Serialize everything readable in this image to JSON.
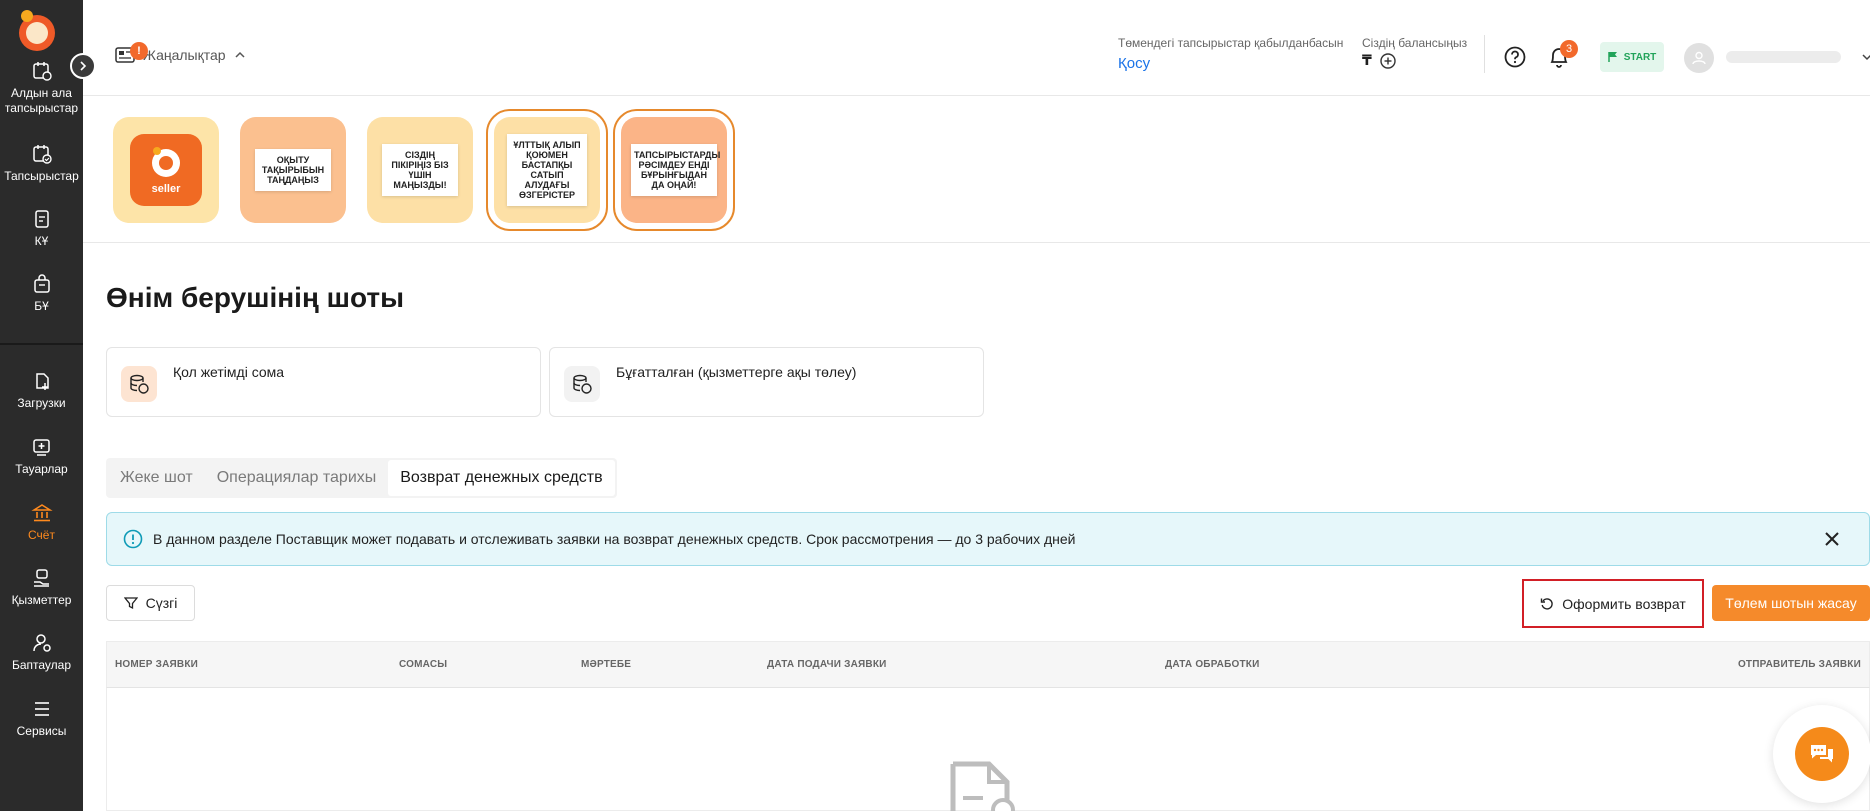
{
  "sidebar": {
    "items": [
      {
        "label": "Алдын ала тапсырыстар",
        "icon": "calendar-clock-icon"
      },
      {
        "label": "Тапсырыстар",
        "icon": "calendar-check-icon"
      },
      {
        "label": "КҰ",
        "icon": "document-icon"
      },
      {
        "label": "БҰ",
        "icon": "bag-icon"
      },
      {
        "label": "Загрузки",
        "icon": "upload-icon"
      },
      {
        "label": "Тауарлар",
        "icon": "add-product-icon"
      },
      {
        "label": "Счёт",
        "icon": "bank-icon",
        "active": true
      },
      {
        "label": "Қызметтер",
        "icon": "services-icon"
      },
      {
        "label": "Баптаулар",
        "icon": "user-settings-icon"
      },
      {
        "label": "Сервисы",
        "icon": "menu-icon"
      }
    ]
  },
  "header": {
    "news_label": "Жаңалықтар",
    "news_badge": "!",
    "bottom_orders_label": "Төмендегі тапсырыстар қабылданбасын",
    "add_link": "Қосу",
    "balance_label": "Сіздің балансыңыз",
    "balance_currency": "₸",
    "bell_count": "3",
    "start_label": "START"
  },
  "stories": [
    {
      "text": "seller",
      "bg": "#fde4a8",
      "type": "logo"
    },
    {
      "text": "ОҚЫТУ ТАҚЫРЫБЫН ТАҢДАҢЫЗ",
      "bg": "#fbc08f"
    },
    {
      "text": "СІЗДІҢ ПІКІРІҢІЗ БІЗ ҮШІН МАҢЫЗДЫ!",
      "bg": "#fde0a6"
    },
    {
      "text": "ҰЛТТЫҚ АЛЫП ҚОЮМЕН БАСТАПҚЫ САТЫП АЛУДАҒЫ ӨЗГЕРІСТЕР",
      "bg": "#fde0a6",
      "bordered": true
    },
    {
      "text": "ТАПСЫРЫСТАРДЫ РӘСІМДЕУ ЕНДІ БҰРЫНҒЫДАН ДА ОҢАЙ!",
      "bg": "#fbb487",
      "bordered": true
    }
  ],
  "main": {
    "title": "Өнім берушінің шоты",
    "cards": [
      {
        "label": "Қол жетімді сома"
      },
      {
        "label": "Бұғатталған (қызметтерге ақы төлеу)"
      }
    ],
    "tabs": [
      "Жеке шот",
      "Операциялар тарихы",
      "Возврат денежных средств"
    ],
    "active_tab": 2,
    "alert_text": "В данном разделе Поставщик может подавать и отслеживать заявки на возврат денежных средств. Срок рассмотрения — до 3 рабочих дней",
    "filter_label": "Сүзгі",
    "refund_button": "Оформить возврат",
    "pay_button": "Төлем шотын жасау",
    "table_headers": [
      "НОМЕР ЗАЯВКИ",
      "СОМАСЫ",
      "МӘРТЕБЕ",
      "ДАТА ПОДАЧИ ЗАЯВКИ",
      "ДАТА ОБРАБОТКИ",
      "ОТПРАВИТЕЛЬ ЗАЯВКИ"
    ]
  },
  "colors": {
    "accent": "#f58a2b",
    "sidebar_bg": "#2b2b2b",
    "active_nav": "#ff8a1e",
    "alert_bg": "#e6f7fa",
    "highlight_border": "#d21f26"
  }
}
